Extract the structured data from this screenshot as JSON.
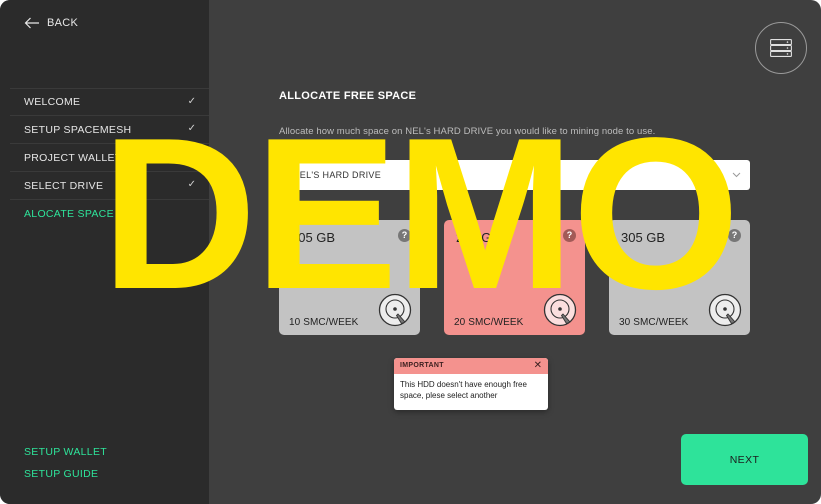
{
  "sidebar": {
    "back_label": "BACK",
    "items": [
      {
        "label": "WELCOME",
        "checked": "✓"
      },
      {
        "label": "SETUP SPACEMESH",
        "checked": "✓"
      },
      {
        "label": "PROJECT WALLET",
        "checked": ""
      },
      {
        "label": "SELECT DRIVE",
        "checked": "✓"
      },
      {
        "label": "ALOCATE SPACE",
        "checked": "",
        "active": true
      }
    ],
    "bottom_links": [
      "SETUP WALLET",
      "SETUP GUIDE"
    ]
  },
  "header": {
    "icon": "server-icon"
  },
  "main": {
    "title": "ALLOCATE FREE SPACE",
    "subtitle": "Allocate how much space on NEL's HARD DRIVE you would like to mining node to use.",
    "drive_select": {
      "value": "NEL'S HARD DRIVE",
      "icon": "chevron-down-icon"
    },
    "cards": [
      {
        "size": "105 GB",
        "price": "10 SMC/WEEK",
        "info": "?",
        "icon": "hard-disk-icon"
      },
      {
        "size": "205 GB",
        "price": "20 SMC/WEEK",
        "info": "?",
        "icon": "hard-disk-icon",
        "state": "error"
      },
      {
        "size": "305 GB",
        "price": "30 SMC/WEEK",
        "info": "?",
        "icon": "hard-disk-icon"
      }
    ],
    "tooltip": {
      "title": "IMPORTANT",
      "close": "✕",
      "message": "This HDD doesn't have enough free space, plese select another"
    },
    "next_label": "NEXT"
  },
  "watermark": "DEMO",
  "colors": {
    "accent": "#2ee39a",
    "sidebar_bg": "#2b2b2b",
    "main_bg": "#3f3f3f",
    "error": "#f4928e",
    "card_bg": "#c3c3c3",
    "watermark": "#ffe500"
  }
}
